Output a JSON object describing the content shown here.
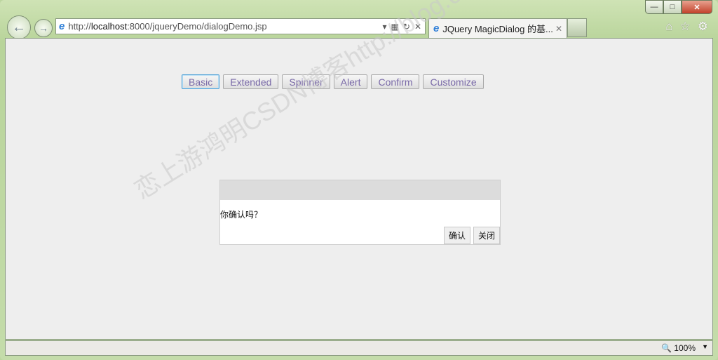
{
  "browser": {
    "url_prefix": "http://",
    "url_host": "localhost",
    "url_rest": ":8000/jqueryDemo/dialogDemo.jsp",
    "tab_title": "JQuery MagicDialog 的基...",
    "zoom": "100%"
  },
  "page": {
    "buttons": [
      "Basic",
      "Extended",
      "Spinner",
      "Alert",
      "Confirm",
      "Customize"
    ],
    "dialog": {
      "message": "你确认吗？",
      "confirm_label": "确认",
      "close_label": "关闭"
    },
    "watermark": "恋上游鸿明CSDN博客http://blog.csdn.net/youqishini"
  }
}
